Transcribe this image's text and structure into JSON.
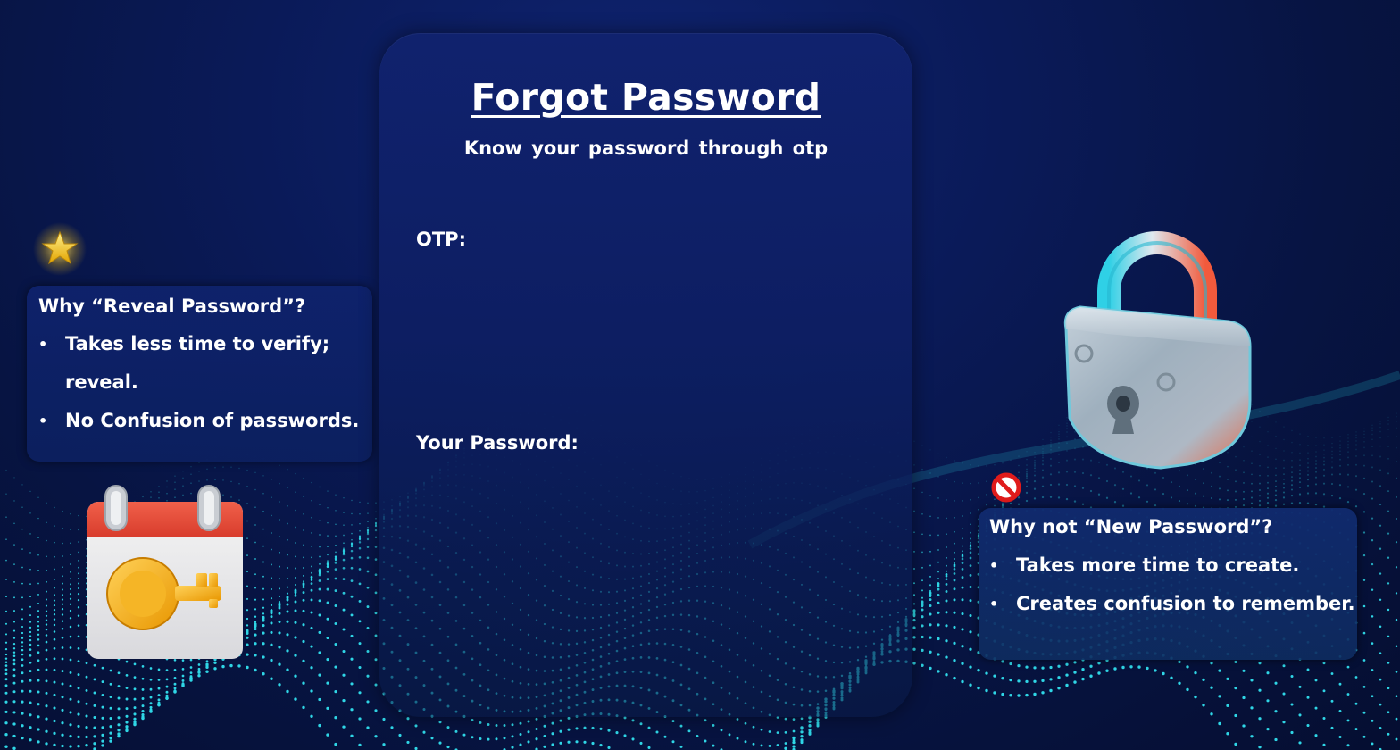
{
  "card": {
    "title": "Forgot Password",
    "subtitle": "Know your password  through otp",
    "otp_label": "OTP:",
    "otp_value": "",
    "password_label": "Your Password:",
    "password_value": ""
  },
  "left_box": {
    "heading": "Why “Reveal Password”?",
    "bullets": [
      "Takes less time to verify; reveal.",
      "No Confusion of  passwords."
    ]
  },
  "right_box": {
    "heading": "Why not “New Password”?",
    "bullets": [
      "Takes more time to create.",
      "Creates confusion to remember."
    ]
  },
  "icons": {
    "star": "star-icon",
    "calendar_key": "calendar-key-icon",
    "padlock": "padlock-icon",
    "prohibited": "prohibited-icon"
  },
  "colors": {
    "background": "#0a1a58",
    "card": "#10226e",
    "dots": "#2fd6e6",
    "text": "#ffffff"
  }
}
